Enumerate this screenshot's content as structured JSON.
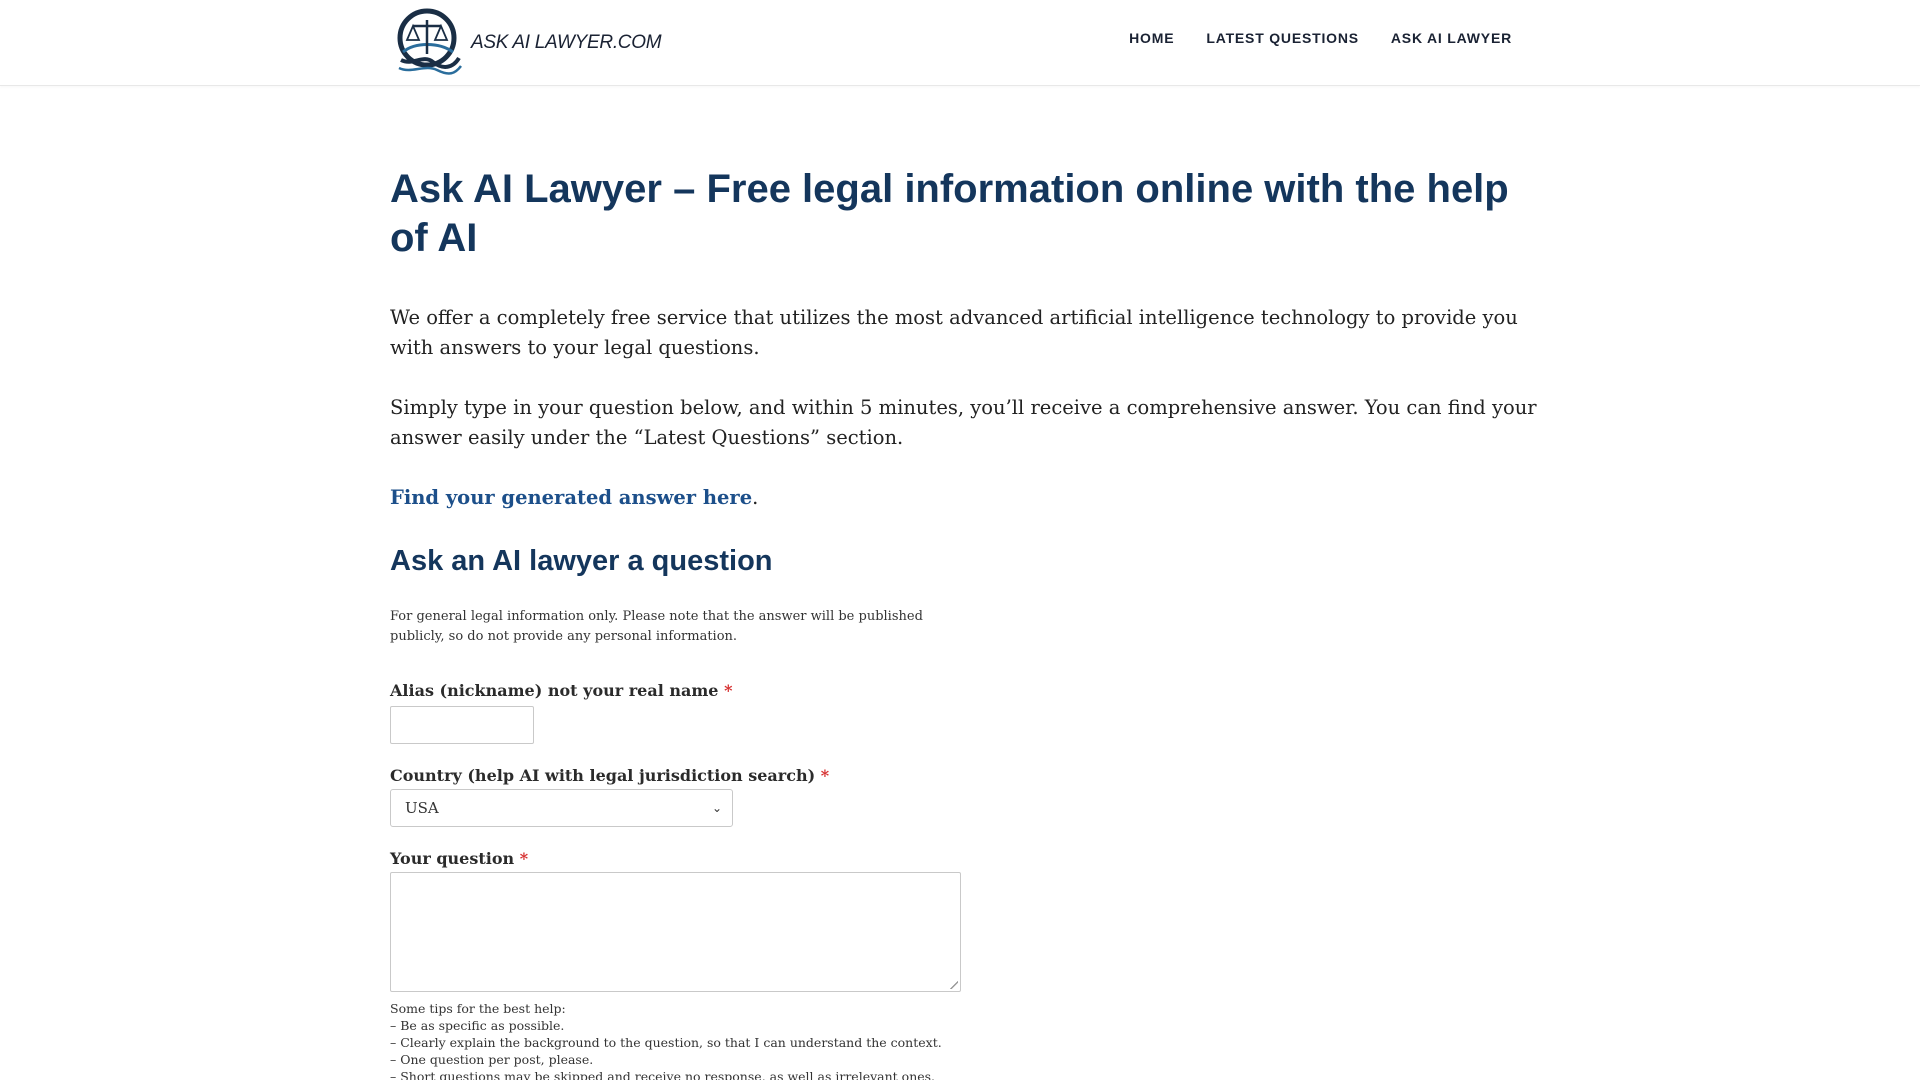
{
  "colors": {
    "heading": "#14365c",
    "link": "#1c4f8a",
    "required": "#d62f2f",
    "logo_dark": "#1a2e45",
    "logo_accent": "#2a6d9c"
  },
  "header": {
    "logo_text": "ASK AI LAWYER.COM",
    "logo_icon": "scales-of-justice-icon",
    "nav": [
      {
        "label": "HOME"
      },
      {
        "label": "LATEST QUESTIONS"
      },
      {
        "label": "ASK AI LAWYER"
      }
    ]
  },
  "main": {
    "title": "Ask AI Lawyer – Free legal information online with the help of AI",
    "intro_1": "We offer a completely free service that utilizes the most advanced artificial intelligence technology to provide you with answers to your legal questions.",
    "intro_2": "Simply type in your question below, and within 5 minutes, you’ll receive a comprehensive answer. You can find your answer easily under the “Latest Questions” section.",
    "answer_link": "Find your generated answer here",
    "answer_link_period": ".",
    "form_heading": "Ask an AI lawyer a question",
    "disclaimer": "For general legal information only. Please note that the answer will be published publicly, so do not provide any personal information."
  },
  "form": {
    "required_mark": "*",
    "alias_label": "Alias (nickname) not your real name",
    "alias_value": "",
    "country_label": "Country (help AI with legal jurisdiction search)",
    "country_value": "USA",
    "question_label": "Your question",
    "question_value": "",
    "tips": [
      "Some tips for the best help:",
      "– Be as specific as possible.",
      "– Clearly explain the background to the question, so that I can understand the context.",
      "– One question per post, please.",
      "– Short questions may be skipped and receive no response, as well as irrelevant ones."
    ]
  }
}
